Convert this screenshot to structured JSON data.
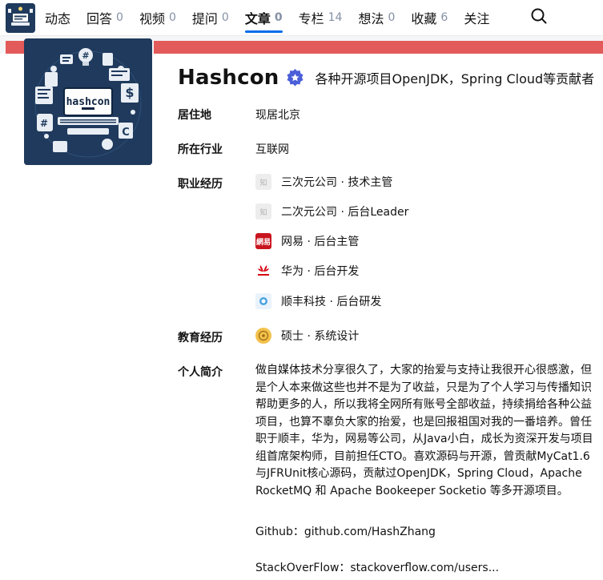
{
  "nav": {
    "tabs": [
      {
        "label": "动态",
        "count": ""
      },
      {
        "label": "回答",
        "count": "0"
      },
      {
        "label": "视频",
        "count": "0"
      },
      {
        "label": "提问",
        "count": "0"
      },
      {
        "label": "文章",
        "count": "0",
        "active": true
      },
      {
        "label": "专栏",
        "count": "14"
      },
      {
        "label": "想法",
        "count": "0"
      },
      {
        "label": "收藏",
        "count": "6"
      },
      {
        "label": "关注",
        "count": ""
      }
    ]
  },
  "profile": {
    "name": "Hashcon",
    "headline": "各种开源项目OpenJDK，Spring Cloud等贡献者",
    "avatar_text": "hashcon"
  },
  "details": {
    "location_label": "居住地",
    "location_value": "现居北京",
    "industry_label": "所在行业",
    "industry_value": "互联网",
    "career_label": "职业经历",
    "career": [
      {
        "icon": "placeholder-company-icon",
        "text": "三次元公司 · 技术主管"
      },
      {
        "icon": "placeholder-company-icon",
        "text": "二次元公司 · 后台Leader"
      },
      {
        "icon": "netease-logo-icon",
        "text": "网易 · 后台主管"
      },
      {
        "icon": "huawei-logo-icon",
        "text": "华为 · 后台开发"
      },
      {
        "icon": "sf-logo-icon",
        "text": "顺丰科技 · 后台研发"
      }
    ],
    "education_label": "教育经历",
    "education": [
      {
        "icon": "school-logo-icon",
        "text": "硕士 · 系统设计"
      }
    ],
    "bio_label": "个人简介",
    "bio": "做自媒体技术分享很久了，大家的抬爱与支持让我很开心很感激，但是个人本来做这些也并不是为了收益，只是为了个人学习与传播知识帮助更多的人，所以我将全网所有账号全部收益，持续捐给各种公益项目，也算不辜负大家的抬爱，也是回报祖国对我的一番培养。曾任职于顺丰，华为，网易等公司，从Java小白，成长为资深开发与项目组首席架构师，目前担任CTO。喜欢源码与开源，曾贡献MyCat1.6与JFRUnit核心源码，贡献过OpenJDK，Spring Cloud，Apache RocketMQ 和 Apache Bookeeper Socketio 等多开源项目。",
    "github": "Github：github.com/HashZhang",
    "stackoverflow": "StackOverFlow：stackoverflow.com/users..."
  },
  "colors": {
    "accent": "#056de8",
    "badge": "#4a5fd8",
    "cover_red": "#e35a5a"
  }
}
